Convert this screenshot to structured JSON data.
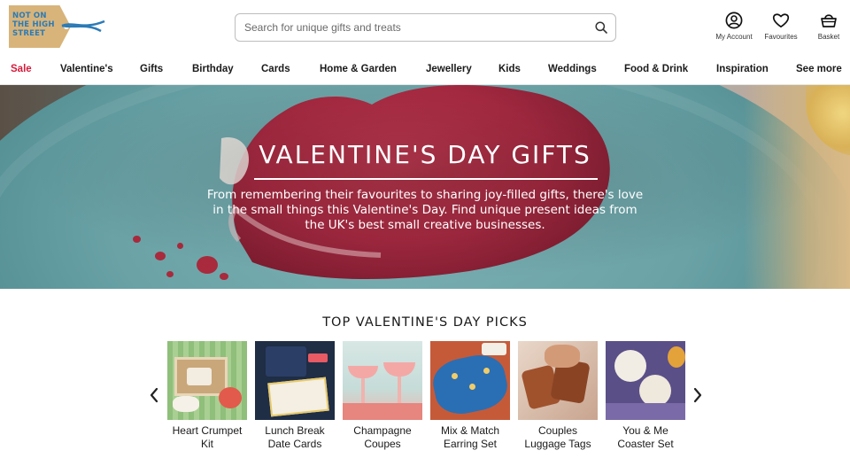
{
  "header": {
    "logo_lines": [
      "NOT ON",
      "THE HIGH",
      "STREET"
    ],
    "search_placeholder": "Search for unique gifts and treats",
    "search_icon": "search-icon",
    "account_label": "My Account",
    "favourites_label": "Favourites",
    "basket_label": "Basket"
  },
  "nav": {
    "items": [
      "Sale",
      "Valentine's",
      "Gifts",
      "Birthday",
      "Cards",
      "Home & Garden",
      "Jewellery",
      "Kids",
      "Weddings",
      "Food & Drink",
      "Inspiration",
      "See more"
    ],
    "sale_color": "#d31b3b"
  },
  "hero": {
    "title": "VALENTINE'S DAY GIFTS",
    "description": "From remembering their favourites to sharing joy-filled gifts, there's love in the small things this Valentine's Day. Find unique present ideas from the UK's best small creative businesses."
  },
  "picks": {
    "title": "TOP VALENTINE'S DAY PICKS",
    "prev_icon": "chevron-left-icon",
    "next_icon": "chevron-right-icon",
    "products": [
      {
        "line1": "Heart Crumpet",
        "line2": "Kit"
      },
      {
        "line1": "Lunch Break",
        "line2": "Date Cards"
      },
      {
        "line1": "Champagne",
        "line2": "Coupes"
      },
      {
        "line1": "Mix & Match",
        "line2": "Earring Set"
      },
      {
        "line1": "Couples",
        "line2": "Luggage Tags"
      },
      {
        "line1": "You & Me",
        "line2": "Coaster Set"
      }
    ]
  },
  "colors": {
    "brand_blue": "#2c7bb6",
    "tag_tan": "#d8b47a",
    "accent_red": "#d31b3b"
  }
}
